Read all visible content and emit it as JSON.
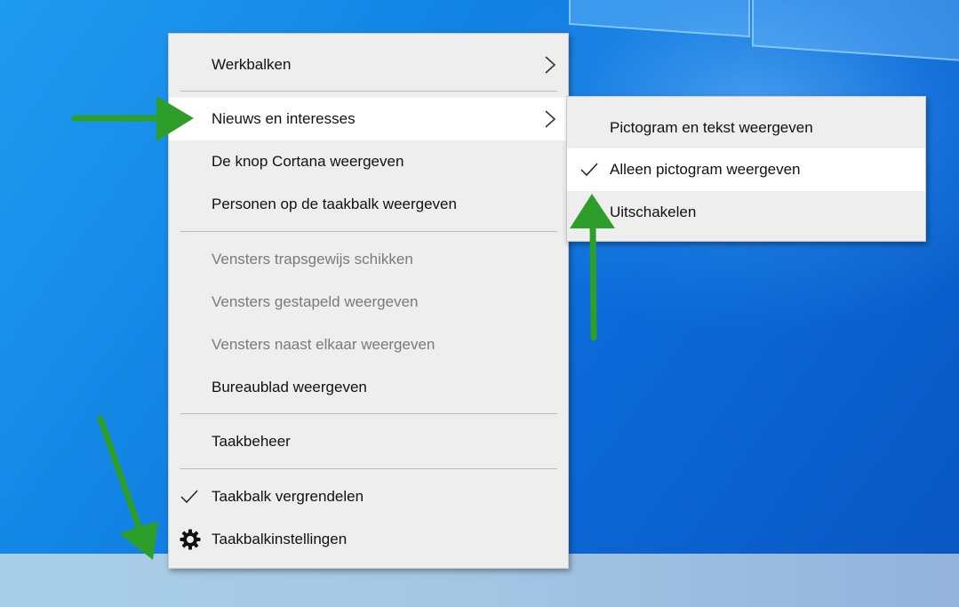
{
  "context_menu": {
    "items": [
      {
        "label": "Werkbalken",
        "submenu": true
      },
      {
        "label": "Nieuws en interesses",
        "submenu": true,
        "highlighted": true
      },
      {
        "label": "De knop Cortana weergeven"
      },
      {
        "label": "Personen op de taakbalk weergeven"
      },
      {
        "label": "Vensters trapsgewijs schikken",
        "disabled": true
      },
      {
        "label": "Vensters gestapeld weergeven",
        "disabled": true
      },
      {
        "label": "Vensters naast elkaar weergeven",
        "disabled": true
      },
      {
        "label": "Bureaublad weergeven"
      },
      {
        "label": "Taakbeheer"
      },
      {
        "label": "Taakbalk vergrendelen",
        "checked": true
      },
      {
        "label": "Taakbalkinstellingen",
        "icon": "gear-icon"
      }
    ]
  },
  "submenu_news": {
    "items": [
      {
        "label": "Pictogram en tekst weergeven"
      },
      {
        "label": "Alleen pictogram weergeven",
        "checked": true,
        "highlighted": true
      },
      {
        "label": "Uitschakelen"
      }
    ]
  },
  "colors": {
    "menu_background": "#eeeeee",
    "highlight": "#ffffff",
    "disabled_text": "#7a7a7a",
    "annotation_arrow": "#2e9e2a",
    "desktop_blue": "#1283e4"
  },
  "annotations": [
    "green-arrow-left",
    "green-arrow-up",
    "green-arrow-down-left"
  ]
}
